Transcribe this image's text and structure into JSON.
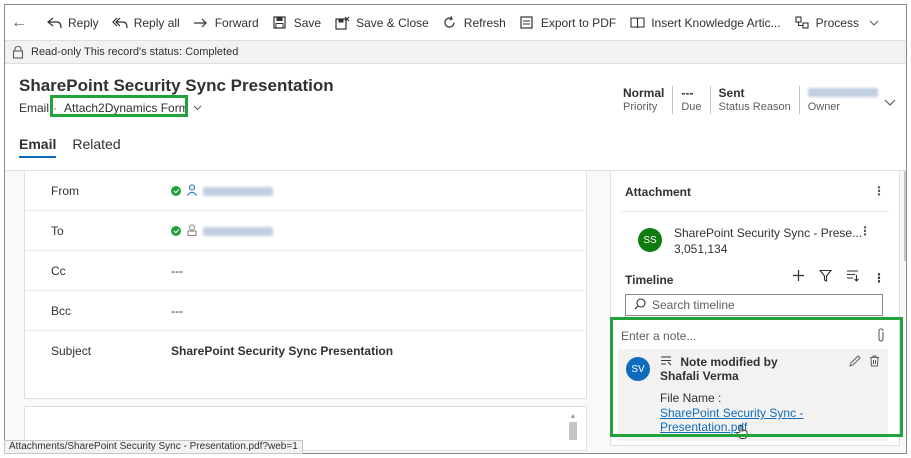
{
  "toolbar": {
    "items": [
      {
        "label": "Reply",
        "icon": "reply-icon"
      },
      {
        "label": "Reply all",
        "icon": "reply-all-icon"
      },
      {
        "label": "Forward",
        "icon": "forward-icon"
      },
      {
        "label": "Save",
        "icon": "save-icon"
      },
      {
        "label": "Save & Close",
        "icon": "save-close-icon"
      },
      {
        "label": "Refresh",
        "icon": "refresh-icon"
      },
      {
        "label": "Export to PDF",
        "icon": "pdf-icon"
      },
      {
        "label": "Insert Knowledge Artic...",
        "icon": "knowledge-icon"
      },
      {
        "label": "Process",
        "icon": "process-icon"
      }
    ]
  },
  "notice": {
    "text": "Read-only This record's status: Completed"
  },
  "header": {
    "title": "SharePoint Security Sync Presentation",
    "entity": "Email",
    "form_name": "Attach2Dynamics Form",
    "fields": [
      {
        "value": "Normal",
        "label": "Priority"
      },
      {
        "value": "---",
        "label": "Due"
      },
      {
        "value": "Sent",
        "label": "Status Reason"
      },
      {
        "value": "",
        "label": "Owner"
      }
    ]
  },
  "tabs": [
    {
      "label": "Email",
      "active": true
    },
    {
      "label": "Related",
      "active": false
    }
  ],
  "form": {
    "rows": [
      {
        "label": "From",
        "value": ""
      },
      {
        "label": "To",
        "value": ""
      },
      {
        "label": "Cc",
        "value": "---"
      },
      {
        "label": "Bcc",
        "value": "---"
      },
      {
        "label": "Subject",
        "value": "SharePoint Security Sync Presentation"
      }
    ]
  },
  "attachment": {
    "heading": "Attachment",
    "initials": "SS",
    "name": "SharePoint Security Sync - Prese...",
    "size": "3,051,134"
  },
  "timeline": {
    "heading": "Timeline",
    "search_placeholder": "Search timeline",
    "note_placeholder": "Enter a note...",
    "note": {
      "initials": "SV",
      "title": "Note modified by Shafali Verma",
      "file_label": "File Name :",
      "file_link": "SharePoint Security Sync - Presentation.pdf"
    }
  },
  "status_bar": {
    "url": "Attachments/SharePoint Security Sync - Presentation.pdf?web=1"
  },
  "colors": {
    "accent": "#0f6cbd",
    "highlight_box": "#22a23a",
    "avatar_attachment": "#107c10",
    "avatar_note": "#0f6cbd"
  }
}
